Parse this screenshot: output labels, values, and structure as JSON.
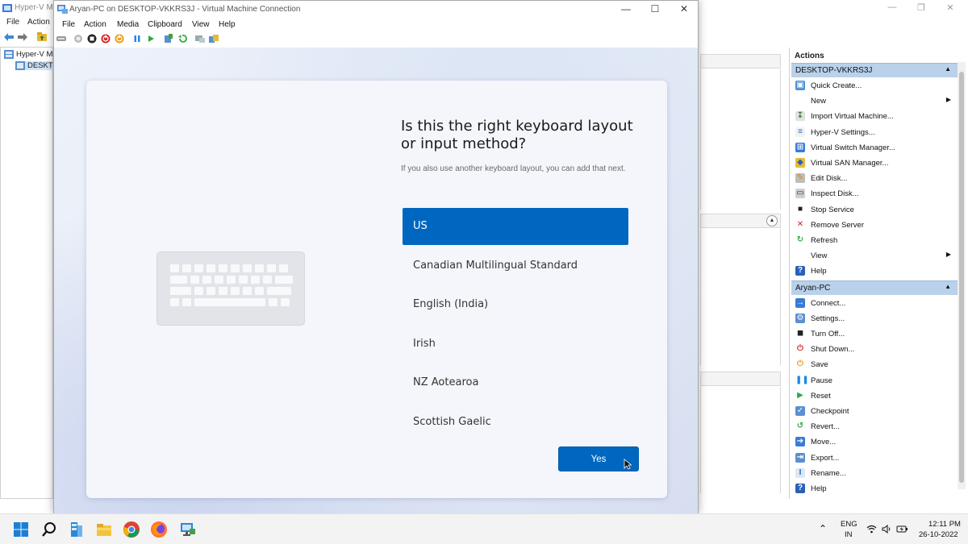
{
  "hyperv": {
    "title": "Hyper-V Ma",
    "menu": [
      "File",
      "Action"
    ],
    "tree": [
      {
        "label": "Hyper-V Ma"
      },
      {
        "label": "DESKTO"
      }
    ],
    "actions_title": "Actions",
    "groups": [
      {
        "title": "DESKTOP-VKKRS3J",
        "items": [
          {
            "label": "Quick Create...",
            "icon": "quick-create-icon",
            "has_submenu": false
          },
          {
            "label": "New",
            "icon": "",
            "has_submenu": true
          },
          {
            "label": "Import Virtual Machine...",
            "icon": "import-icon",
            "has_submenu": false
          },
          {
            "label": "Hyper-V Settings...",
            "icon": "settings-doc-icon",
            "has_submenu": false
          },
          {
            "label": "Virtual Switch Manager...",
            "icon": "switch-icon",
            "has_submenu": false
          },
          {
            "label": "Virtual SAN Manager...",
            "icon": "san-icon",
            "has_submenu": false
          },
          {
            "label": "Edit Disk...",
            "icon": "edit-disk-icon",
            "has_submenu": false
          },
          {
            "label": "Inspect Disk...",
            "icon": "inspect-disk-icon",
            "has_submenu": false
          },
          {
            "label": "Stop Service",
            "icon": "stop-icon",
            "has_submenu": false
          },
          {
            "label": "Remove Server",
            "icon": "remove-icon",
            "has_submenu": false
          },
          {
            "label": "Refresh",
            "icon": "refresh-icon",
            "has_submenu": false
          },
          {
            "label": "View",
            "icon": "",
            "has_submenu": true
          },
          {
            "label": "Help",
            "icon": "help-icon",
            "has_submenu": false
          }
        ]
      },
      {
        "title": "Aryan-PC",
        "items": [
          {
            "label": "Connect...",
            "icon": "connect-icon",
            "has_submenu": false
          },
          {
            "label": "Settings...",
            "icon": "settings-icon",
            "has_submenu": false
          },
          {
            "label": "Turn Off...",
            "icon": "turn-off-icon",
            "has_submenu": false
          },
          {
            "label": "Shut Down...",
            "icon": "shut-down-icon",
            "has_submenu": false
          },
          {
            "label": "Save",
            "icon": "save-icon",
            "has_submenu": false
          },
          {
            "label": "Pause",
            "icon": "pause-icon",
            "has_submenu": false
          },
          {
            "label": "Reset",
            "icon": "reset-icon",
            "has_submenu": false
          },
          {
            "label": "Checkpoint",
            "icon": "checkpoint-icon",
            "has_submenu": false
          },
          {
            "label": "Revert...",
            "icon": "revert-icon",
            "has_submenu": false
          },
          {
            "label": "Move...",
            "icon": "move-icon",
            "has_submenu": false
          },
          {
            "label": "Export...",
            "icon": "export-icon",
            "has_submenu": false
          },
          {
            "label": "Rename...",
            "icon": "rename-icon",
            "has_submenu": false
          },
          {
            "label": "Help",
            "icon": "help-icon",
            "has_submenu": false
          }
        ]
      }
    ]
  },
  "vmconnect": {
    "title": "Aryan-PC on DESKTOP-VKKRS3J - Virtual Machine Connection",
    "menu": [
      "File",
      "Action",
      "Media",
      "Clipboard",
      "View",
      "Help"
    ]
  },
  "oobe": {
    "question": "Is this the right keyboard layout or input method?",
    "subtitle": "If you also use another keyboard layout, you can add that next.",
    "layouts": [
      "US",
      "Canadian Multilingual Standard",
      "English (India)",
      "Irish",
      "NZ Aotearoa",
      "Scottish Gaelic"
    ],
    "selected_index": 0,
    "yes_label": "Yes"
  },
  "taskbar": {
    "language": "ENG",
    "region": "IN",
    "time": "12:11 PM",
    "date": "26-10-2022"
  },
  "colors": {
    "accent": "#0067c0",
    "group_header": "#b9d1ea"
  }
}
